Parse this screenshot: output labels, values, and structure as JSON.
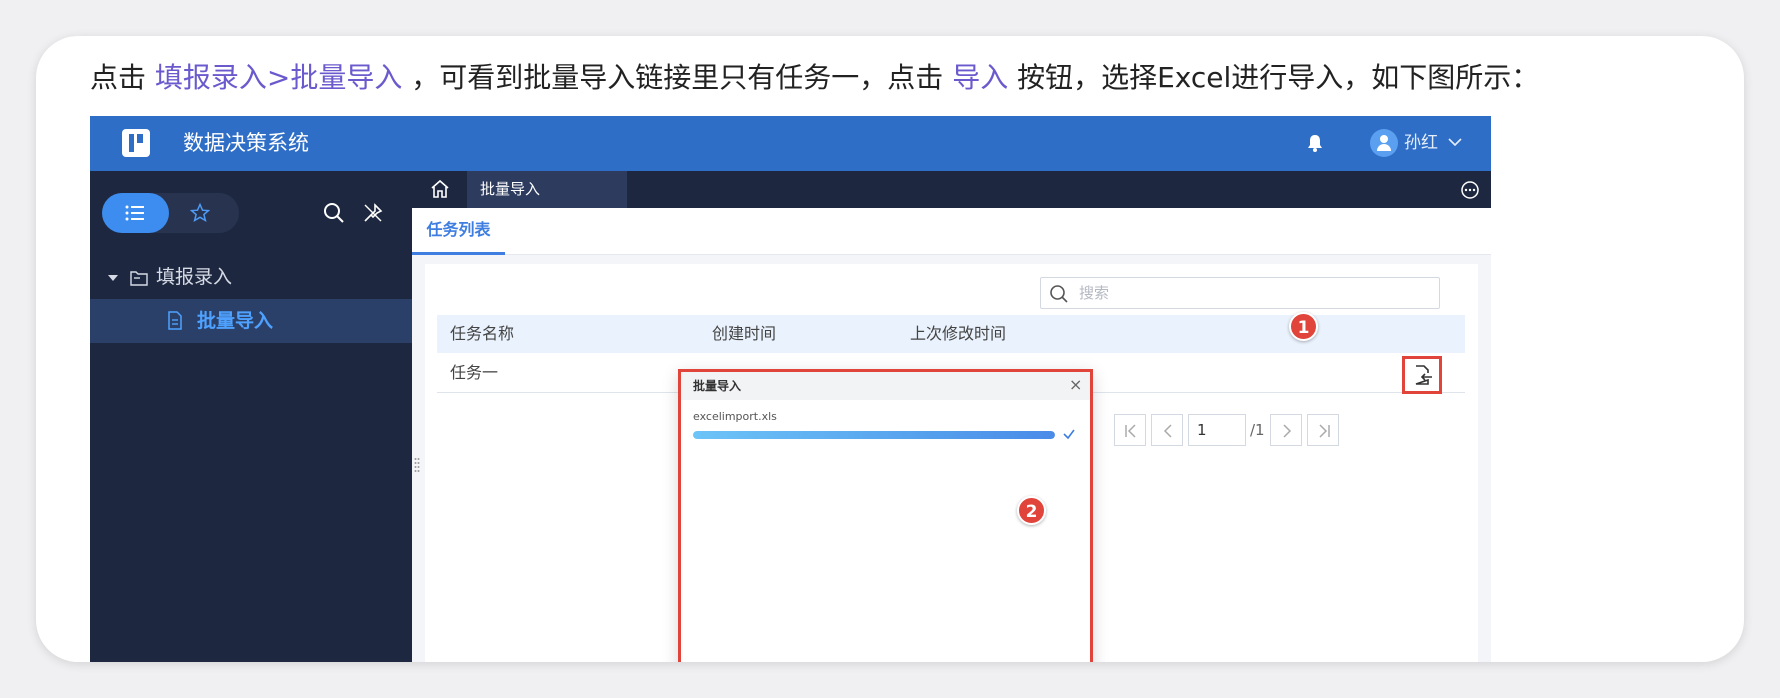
{
  "intro": {
    "prefix": "点击 ",
    "link1": "填报录入>批量导入",
    "middle": " ，可看到批量导入链接里只有任务一，点击 ",
    "link2": "导入",
    "suffix": " 按钮，选择Excel进行导入，如下图所示："
  },
  "app": {
    "title": "数据决策系统",
    "username": "孙红"
  },
  "sidebar": {
    "tree_parent": "填报录入",
    "tree_child": "批量导入"
  },
  "tabs": {
    "active": "批量导入"
  },
  "subtab": {
    "label": "任务列表"
  },
  "search": {
    "placeholder": "搜索"
  },
  "table": {
    "columns": [
      "任务名称",
      "创建时间",
      "上次修改时间"
    ],
    "rows": [
      {
        "name": "任务一"
      }
    ]
  },
  "pager": {
    "page": "1",
    "total": "/1"
  },
  "dialog": {
    "title": "批量导入",
    "close": "×",
    "file_name": "excelimport.xls",
    "progress": 1.0
  },
  "badges": [
    "1",
    "2"
  ],
  "colors": {
    "topbar": "#2f6ec6",
    "sidebar": "#1d2840",
    "accent": "#3d7ee0",
    "annotation": "#e0443a",
    "link": "#6a5acd"
  }
}
